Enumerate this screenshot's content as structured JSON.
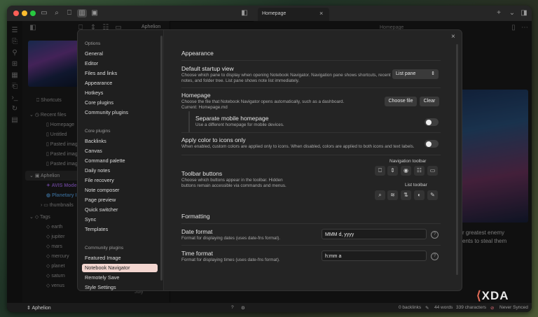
{
  "titlebar": {
    "tab_title": "Homepage"
  },
  "toolbar": {
    "vault_label": "Aphelion",
    "note_title": "Homepage"
  },
  "sidebar": {
    "shortcuts": "Shortcuts",
    "recent_files": "Recent files",
    "recent": [
      "Homepage",
      "Untitled",
      "Pasted image",
      "Pasted image",
      "Pasted image"
    ],
    "vault": "Aphelion",
    "folders": [
      "AVIS Models",
      "Planetary Info",
      "thumbnails"
    ],
    "tags_label": "Tags",
    "tags": [
      "earth",
      "jupiter",
      "mars",
      "mercury",
      "planet",
      "saturn",
      "venus"
    ]
  },
  "settings_nav": {
    "options_header": "Options",
    "options": [
      "General",
      "Editor",
      "Files and links",
      "Appearance",
      "Hotkeys",
      "Core plugins",
      "Community plugins"
    ],
    "core_header": "Core plugins",
    "core": [
      "Backlinks",
      "Canvas",
      "Command palette",
      "Daily notes",
      "File recovery",
      "Note composer",
      "Page preview",
      "Quick switcher",
      "Sync",
      "Templates"
    ],
    "community_header": "Community plugins",
    "community": [
      "Featured Image",
      "Notebook Navigator",
      "Remotely Save",
      "Style Settings"
    ]
  },
  "settings": {
    "section_appearance": "Appearance",
    "startup_title": "Default startup view",
    "startup_desc": "Choose which pane to display when opening Notebook Navigator. Navigation pane shows shortcuts, recent notes, and folder tree. List pane shows note list immediately.",
    "startup_value": "List pane",
    "homepage_title": "Homepage",
    "homepage_desc": "Choose the file that Notebook Navigator opens automatically, such as a dashboard.",
    "homepage_current": "Current: Homepage.md",
    "choose_file": "Choose file",
    "clear": "Clear",
    "mobile_title": "Separate mobile homepage",
    "mobile_desc": "Use a different homepage for mobile devices.",
    "color_title": "Apply color to icons only",
    "color_desc": "When enabled, custom colors are applied only to icons. When disabled, colors are applied to both icons and text labels.",
    "toolbar_title": "Toolbar buttons",
    "toolbar_desc": "Choose which buttons appear in the toolbar. Hidden buttons remain accessible via commands and menus.",
    "nav_toolbar": "Navigation toolbar",
    "list_toolbar": "List toolbar",
    "section_formatting": "Formatting",
    "date_title": "Date format",
    "date_desc": "Format for displaying dates (uses date-fns format).",
    "date_value": "MMM d, yyyy",
    "time_title": "Time format",
    "time_desc": "Format for displaying times (uses date-fns format).",
    "time_value": "h:mm a"
  },
  "note": {
    "line1": "r greatest enemy",
    "line2": "ents to steal them",
    "footer_month": "July"
  },
  "status": {
    "vault": "Aphelion",
    "backlinks": "0 backlinks",
    "words": "44 words",
    "characters": "339 characters",
    "sync": "Never Synced"
  },
  "watermark": "XDA",
  "colors": {
    "accent": "#a96ef0",
    "selected": "#f3d6d0"
  }
}
